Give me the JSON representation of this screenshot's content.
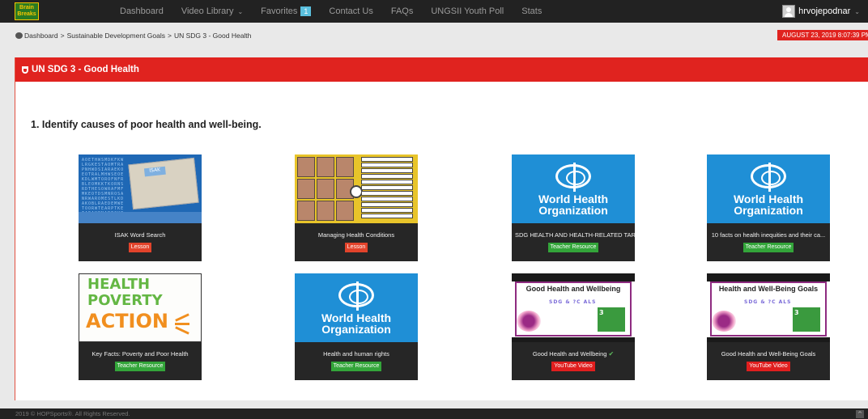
{
  "nav": {
    "logo_top": "Brain",
    "logo_bottom": "Breaks",
    "items": [
      {
        "label": "Dashboard"
      },
      {
        "label": "Video Library"
      },
      {
        "label": "Favorites",
        "badge": "1"
      },
      {
        "label": "Contact Us"
      },
      {
        "label": "FAQs"
      },
      {
        "label": "UNGSII Youth Poll"
      },
      {
        "label": "Stats"
      }
    ],
    "username": "hrvojepodnar"
  },
  "breadcrumb": {
    "home": "Dashboard",
    "sep": ">",
    "level2": "Sustainable Development Goals",
    "level3": "UN SDG 3 - Good Health"
  },
  "datetime": "AUGUST 23, 2019 8:07:39 PM",
  "panel": {
    "title": "UN SDG 3 - Good Health",
    "section_title": "1. Identify causes of poor health and well-being."
  },
  "cards": [
    {
      "title": "ISAK Word Search",
      "tag": "Lesson",
      "tag_color": "#e2432b"
    },
    {
      "title": "Managing Health Conditions",
      "tag": "Lesson",
      "tag_color": "#e2432b"
    },
    {
      "title": "SDG HEALTH AND HEALTH-RELATED TAR...",
      "tag": "Teacher Resource",
      "tag_color": "#33a53a"
    },
    {
      "title": "10 facts on health inequities and their ca...",
      "tag": "Teacher Resource",
      "tag_color": "#33a53a"
    },
    {
      "title": "Key Facts: Poverty and Poor Health",
      "tag": "Teacher Resource",
      "tag_color": "#33a53a"
    },
    {
      "title": "Health and human rights",
      "tag": "Teacher Resource",
      "tag_color": "#33a53a"
    },
    {
      "title": "Good Health and Wellbeing",
      "tag": "YouTube Video",
      "tag_color": "#e01e1e",
      "checked": true
    },
    {
      "title": "Good Health and Well-Being Goals",
      "tag": "YouTube Video",
      "tag_color": "#e01e1e"
    }
  ],
  "thumbs": {
    "isak_label": "ISAK",
    "who_line1": "World Health",
    "who_line2": "Organization",
    "hpa_line1": "HEALTH",
    "hpa_line2": "POVERTY",
    "hpa_line3": "ACTION",
    "yt1_title": "Good Health and Wellbeing",
    "yt2_title": "Health and Well-Being Goals",
    "yt_sub": "SDG & ?C ALS",
    "sdg_num": "3"
  },
  "footer": {
    "copyright": "2019 © HOPSports®. All Rights Reserved."
  }
}
